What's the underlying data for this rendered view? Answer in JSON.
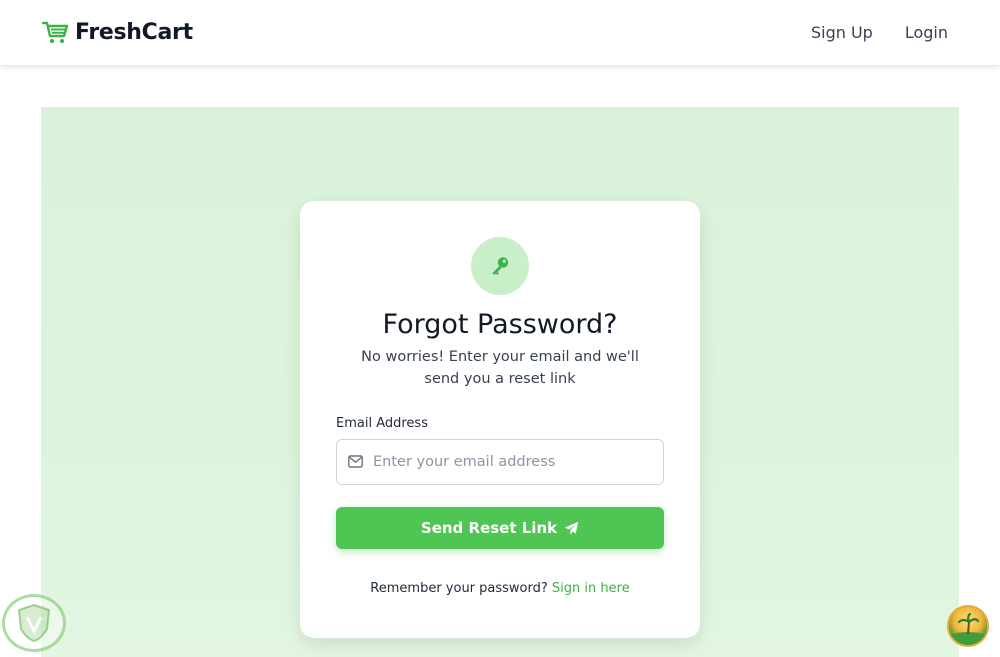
{
  "brand": {
    "name": "FreshCart",
    "icon": "shopping-cart-icon",
    "color": "#3cb34a"
  },
  "nav": {
    "signup": "Sign Up",
    "login": "Login"
  },
  "card": {
    "title": "Forgot Password?",
    "subtitle": "No worries! Enter your email and we'll send you a reset link",
    "icon": "key-icon",
    "email_label": "Email Address",
    "email_placeholder": "Enter your email address",
    "email_value": "",
    "submit_label": "Send Reset Link",
    "submit_icon": "paper-plane-icon",
    "remember_text": "Remember your password?",
    "signin_link": "Sign in here"
  },
  "colors": {
    "accent": "#4fc553",
    "link": "#3cb34a",
    "hero_bg": "#dcf4dc",
    "icon_bg": "#c9efc9"
  }
}
